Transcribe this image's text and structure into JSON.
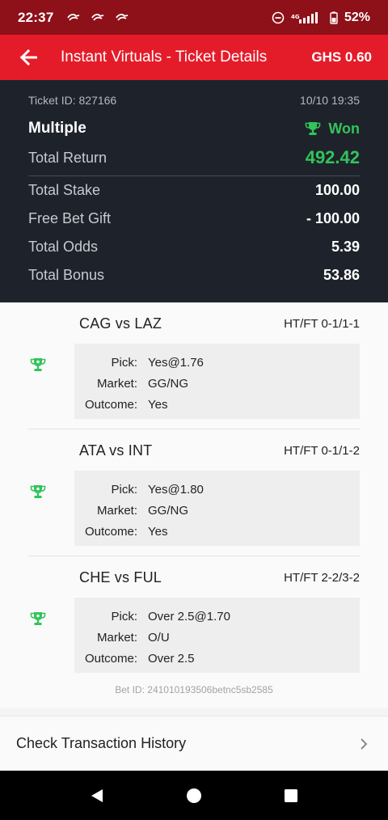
{
  "status_bar": {
    "time": "22:37",
    "battery": "52%",
    "notification_icons": [
      "notif-icon",
      "notif-icon",
      "notif-icon"
    ]
  },
  "app_bar": {
    "title": "Instant Virtuals - Ticket Details",
    "balance": "GHS 0.60",
    "color": "#e41c2a"
  },
  "ticket": {
    "id_label": "Ticket ID: 827166",
    "datetime": "10/10 19:35",
    "type": "Multiple",
    "status": "Won",
    "total_return_label": "Total Return",
    "total_return": "492.42",
    "rows": [
      {
        "label": "Total Stake",
        "value": "100.00"
      },
      {
        "label": "Free Bet Gift",
        "value": "- 100.00"
      },
      {
        "label": "Total Odds",
        "value": "5.39"
      },
      {
        "label": "Total Bonus",
        "value": "53.86"
      }
    ]
  },
  "bets": [
    {
      "match": "CAG vs LAZ",
      "market_code": "HT/FT 0-1/1-1",
      "pick_label": "Pick:",
      "pick": "Yes@1.76",
      "market_label": "Market:",
      "market": "GG/NG",
      "outcome_label": "Outcome:",
      "outcome": "Yes"
    },
    {
      "match": "ATA vs INT",
      "market_code": "HT/FT 0-1/1-2",
      "pick_label": "Pick:",
      "pick": "Yes@1.80",
      "market_label": "Market:",
      "market": "GG/NG",
      "outcome_label": "Outcome:",
      "outcome": "Yes"
    },
    {
      "match": "CHE vs FUL",
      "market_code": "HT/FT 2-2/3-2",
      "pick_label": "Pick:",
      "pick": "Over 2.5@1.70",
      "market_label": "Market:",
      "market": "O/U",
      "outcome_label": "Outcome:",
      "outcome": "Over 2.5"
    }
  ],
  "bet_id": "Bet ID: 241010193506betnc5sb2585",
  "history_link": "Check Transaction History",
  "colors": {
    "won_green": "#31c45a",
    "summary_bg": "#1e232b",
    "status_bar": "#8e1019"
  }
}
